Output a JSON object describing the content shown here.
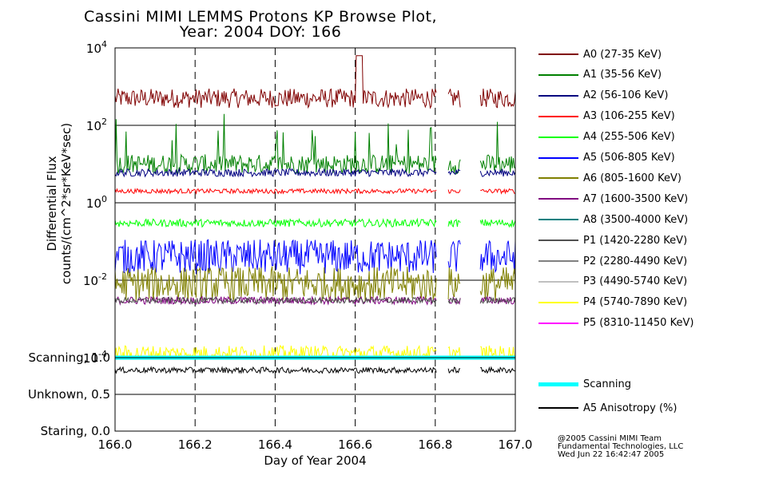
{
  "title_line1": "Cassini MIMI LEMMS Protons KP Browse Plot,",
  "title_line2": "Year: 2004 DOY: 166",
  "footer": {
    "line1": "@2005 Cassini MIMI Team",
    "line2": "Fundamental Technologies, LLC",
    "line3": "Wed Jun 22 16:42:47 2005"
  },
  "colors": {
    "A0": "#800000",
    "A1": "#008000",
    "A2": "#000080",
    "A3": "#ff0000",
    "A4": "#00ff00",
    "A5": "#0000ff",
    "A6": "#808000",
    "A7": "#800080",
    "A8": "#008080",
    "P1": "#505050",
    "P2": "#808080",
    "P3": "#c0c0c0",
    "P4": "#ffff00",
    "P5": "#ff00ff",
    "scanning": "#00ffff",
    "anisotropy": "#000000"
  },
  "chart_data": [
    {
      "type": "line",
      "panel": "flux",
      "ylabel_line1": "Differential Flux",
      "ylabel_line2": "counts/(cm^2*sr*KeV*sec)",
      "xlim": [
        166.0,
        167.0
      ],
      "ylim": [
        0.0001,
        10000
      ],
      "yscale": "log",
      "ytick_values": [
        0.0001,
        0.01,
        1,
        100,
        10000
      ],
      "ytick_exponents": [
        "-4",
        "-2",
        "0",
        "2",
        "4"
      ],
      "ytick_base": "10",
      "vertical_dashed_lines": [
        166.2,
        166.4,
        166.6,
        166.8
      ],
      "legend_position": "right",
      "series": [
        {
          "name": "A0 (27-35 KeV)",
          "key": "A0",
          "level": 500,
          "noise": 0.25,
          "data_gaps": [
            [
              166.805,
              166.83
            ],
            [
              166.865,
              166.91
            ]
          ]
        },
        {
          "name": "A1 (35-56 KeV)",
          "key": "A1",
          "level": 10,
          "noise": 0.25,
          "data_gaps": [
            [
              166.805,
              166.83
            ],
            [
              166.865,
              166.91
            ]
          ]
        },
        {
          "name": "A2 (56-106 KeV)",
          "key": "A2",
          "level": 6,
          "noise": 0.1,
          "data_gaps": [
            [
              166.805,
              166.83
            ],
            [
              166.865,
              166.91
            ]
          ]
        },
        {
          "name": "A3 (106-255 KeV)",
          "key": "A3",
          "level": 2,
          "noise": 0.06,
          "data_gaps": [
            [
              166.805,
              166.83
            ],
            [
              166.865,
              166.91
            ]
          ]
        },
        {
          "name": "A4 (255-506 KeV)",
          "key": "A4",
          "level": 0.3,
          "noise": 0.1,
          "data_gaps": [
            [
              166.805,
              166.83
            ],
            [
              166.865,
              166.91
            ]
          ]
        },
        {
          "name": "A5 (506-805 KeV)",
          "key": "A5",
          "level": 0.04,
          "noise": 0.45,
          "data_gaps": [
            [
              166.805,
              166.83
            ],
            [
              166.865,
              166.91
            ]
          ]
        },
        {
          "name": "A6 (805-1600 KeV)",
          "key": "A6",
          "level": 0.008,
          "noise": 0.45,
          "data_gaps": [
            [
              166.805,
              166.83
            ],
            [
              166.865,
              166.91
            ]
          ]
        },
        {
          "name": "A7 (1600-3500 KeV)",
          "key": "A7",
          "level": 0.003,
          "noise": 0.1,
          "data_gaps": [
            [
              166.805,
              166.83
            ],
            [
              166.865,
              166.91
            ]
          ]
        },
        {
          "name": "A8 (3500-4000 KeV)",
          "key": "A8",
          "level": 0.0001,
          "noise": 0,
          "data_gaps": []
        },
        {
          "name": "P1 (1420-2280 KeV)",
          "key": "P1",
          "level": 0.003,
          "noise": 0.08,
          "data_gaps": [
            [
              166.805,
              166.83
            ],
            [
              166.865,
              166.91
            ]
          ]
        },
        {
          "name": "P2 (2280-4490 KeV)",
          "key": "P2",
          "level": 0.0001,
          "noise": 0,
          "data_gaps": []
        },
        {
          "name": "P3 (4490-5740 KeV)",
          "key": "P3",
          "level": 0.0001,
          "noise": 0,
          "data_gaps": []
        },
        {
          "name": "P4 (5740-7890 KeV)",
          "key": "P4",
          "level": 0.00013,
          "noise": 0.2,
          "data_gaps": [
            [
              166.805,
              166.83
            ],
            [
              166.865,
              166.91
            ]
          ]
        },
        {
          "name": "P5 (8310-11450 KeV)",
          "key": "P5",
          "level": 0.0001,
          "noise": 0,
          "data_gaps": []
        }
      ]
    },
    {
      "type": "line",
      "panel": "anisotropy",
      "xlim": [
        166.0,
        167.0
      ],
      "ylim": [
        0.0,
        1.0
      ],
      "ytick_labels": [
        "Staring, 0.0",
        "Unknown, 0.5",
        "Scanning, 1.0"
      ],
      "ytick_values": [
        0.0,
        0.5,
        1.0
      ],
      "xlabel": "Day of Year 2004",
      "xtick_labels": [
        "166.0",
        "166.2",
        "166.4",
        "166.6",
        "166.8",
        "167.0"
      ],
      "xtick_values": [
        166.0,
        166.2,
        166.4,
        166.6,
        166.8,
        167.0
      ],
      "vertical_dashed_lines": [
        166.2,
        166.4,
        166.6,
        166.8
      ],
      "series": [
        {
          "name": "Scanning",
          "key": "scanning",
          "value": 1.0
        },
        {
          "name": "A5 Anisotropy (%)",
          "key": "anisotropy",
          "level": 0.83,
          "noise": 0.04
        }
      ]
    }
  ]
}
